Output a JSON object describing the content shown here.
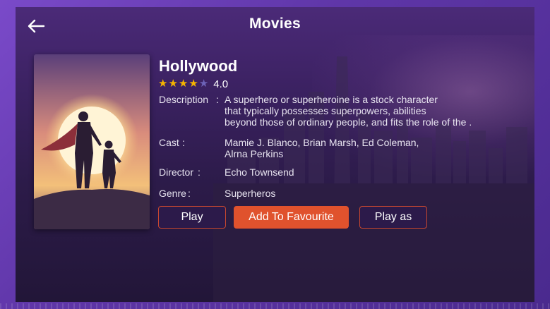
{
  "header": {
    "title": "Movies",
    "back_icon": "arrow-left-icon"
  },
  "movie": {
    "title": "Hollywood",
    "rating": {
      "value": "4.0",
      "stars_filled": 4,
      "stars_total": 5
    },
    "description": {
      "label": "Description",
      "lines": [
        "A superhero or superheroine is a stock character",
        "that typically possesses superpowers, abilities",
        "beyond those of ordinary people, and fits the role of the ."
      ]
    },
    "cast": {
      "label": "Cast",
      "lines": [
        "Mamie J. Blanco, Brian Marsh,  Ed Coleman,",
        "Alrna Perkins"
      ]
    },
    "director": {
      "label": "Director",
      "value": "Echo Townsend"
    },
    "genre": {
      "label": "Genre",
      "value": "Superheros"
    }
  },
  "actions": {
    "play": "Play",
    "add_favourite": "Add To Favourite",
    "play_as": "Play as"
  },
  "colors": {
    "accent": "#e0522d",
    "star": "#f4b400",
    "star_empty": "#6d63b8"
  }
}
